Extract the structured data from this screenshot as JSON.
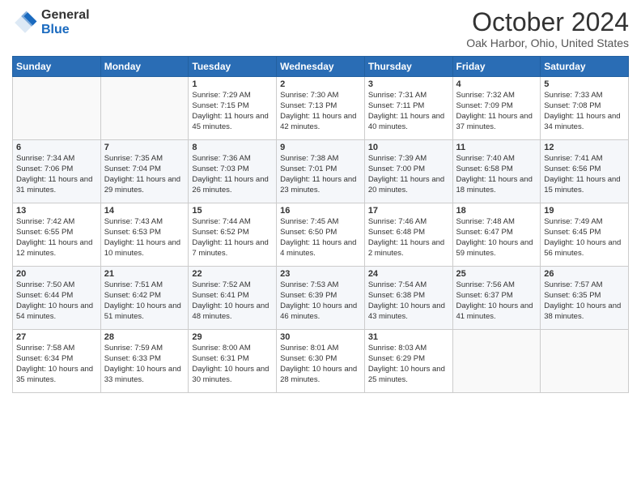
{
  "logo": {
    "general": "General",
    "blue": "Blue"
  },
  "header": {
    "title": "October 2024",
    "subtitle": "Oak Harbor, Ohio, United States"
  },
  "weekdays": [
    "Sunday",
    "Monday",
    "Tuesday",
    "Wednesday",
    "Thursday",
    "Friday",
    "Saturday"
  ],
  "weeks": [
    [
      {
        "day": "",
        "sunrise": "",
        "sunset": "",
        "daylight": ""
      },
      {
        "day": "",
        "sunrise": "",
        "sunset": "",
        "daylight": ""
      },
      {
        "day": "1",
        "sunrise": "Sunrise: 7:29 AM",
        "sunset": "Sunset: 7:15 PM",
        "daylight": "Daylight: 11 hours and 45 minutes."
      },
      {
        "day": "2",
        "sunrise": "Sunrise: 7:30 AM",
        "sunset": "Sunset: 7:13 PM",
        "daylight": "Daylight: 11 hours and 42 minutes."
      },
      {
        "day": "3",
        "sunrise": "Sunrise: 7:31 AM",
        "sunset": "Sunset: 7:11 PM",
        "daylight": "Daylight: 11 hours and 40 minutes."
      },
      {
        "day": "4",
        "sunrise": "Sunrise: 7:32 AM",
        "sunset": "Sunset: 7:09 PM",
        "daylight": "Daylight: 11 hours and 37 minutes."
      },
      {
        "day": "5",
        "sunrise": "Sunrise: 7:33 AM",
        "sunset": "Sunset: 7:08 PM",
        "daylight": "Daylight: 11 hours and 34 minutes."
      }
    ],
    [
      {
        "day": "6",
        "sunrise": "Sunrise: 7:34 AM",
        "sunset": "Sunset: 7:06 PM",
        "daylight": "Daylight: 11 hours and 31 minutes."
      },
      {
        "day": "7",
        "sunrise": "Sunrise: 7:35 AM",
        "sunset": "Sunset: 7:04 PM",
        "daylight": "Daylight: 11 hours and 29 minutes."
      },
      {
        "day": "8",
        "sunrise": "Sunrise: 7:36 AM",
        "sunset": "Sunset: 7:03 PM",
        "daylight": "Daylight: 11 hours and 26 minutes."
      },
      {
        "day": "9",
        "sunrise": "Sunrise: 7:38 AM",
        "sunset": "Sunset: 7:01 PM",
        "daylight": "Daylight: 11 hours and 23 minutes."
      },
      {
        "day": "10",
        "sunrise": "Sunrise: 7:39 AM",
        "sunset": "Sunset: 7:00 PM",
        "daylight": "Daylight: 11 hours and 20 minutes."
      },
      {
        "day": "11",
        "sunrise": "Sunrise: 7:40 AM",
        "sunset": "Sunset: 6:58 PM",
        "daylight": "Daylight: 11 hours and 18 minutes."
      },
      {
        "day": "12",
        "sunrise": "Sunrise: 7:41 AM",
        "sunset": "Sunset: 6:56 PM",
        "daylight": "Daylight: 11 hours and 15 minutes."
      }
    ],
    [
      {
        "day": "13",
        "sunrise": "Sunrise: 7:42 AM",
        "sunset": "Sunset: 6:55 PM",
        "daylight": "Daylight: 11 hours and 12 minutes."
      },
      {
        "day": "14",
        "sunrise": "Sunrise: 7:43 AM",
        "sunset": "Sunset: 6:53 PM",
        "daylight": "Daylight: 11 hours and 10 minutes."
      },
      {
        "day": "15",
        "sunrise": "Sunrise: 7:44 AM",
        "sunset": "Sunset: 6:52 PM",
        "daylight": "Daylight: 11 hours and 7 minutes."
      },
      {
        "day": "16",
        "sunrise": "Sunrise: 7:45 AM",
        "sunset": "Sunset: 6:50 PM",
        "daylight": "Daylight: 11 hours and 4 minutes."
      },
      {
        "day": "17",
        "sunrise": "Sunrise: 7:46 AM",
        "sunset": "Sunset: 6:48 PM",
        "daylight": "Daylight: 11 hours and 2 minutes."
      },
      {
        "day": "18",
        "sunrise": "Sunrise: 7:48 AM",
        "sunset": "Sunset: 6:47 PM",
        "daylight": "Daylight: 10 hours and 59 minutes."
      },
      {
        "day": "19",
        "sunrise": "Sunrise: 7:49 AM",
        "sunset": "Sunset: 6:45 PM",
        "daylight": "Daylight: 10 hours and 56 minutes."
      }
    ],
    [
      {
        "day": "20",
        "sunrise": "Sunrise: 7:50 AM",
        "sunset": "Sunset: 6:44 PM",
        "daylight": "Daylight: 10 hours and 54 minutes."
      },
      {
        "day": "21",
        "sunrise": "Sunrise: 7:51 AM",
        "sunset": "Sunset: 6:42 PM",
        "daylight": "Daylight: 10 hours and 51 minutes."
      },
      {
        "day": "22",
        "sunrise": "Sunrise: 7:52 AM",
        "sunset": "Sunset: 6:41 PM",
        "daylight": "Daylight: 10 hours and 48 minutes."
      },
      {
        "day": "23",
        "sunrise": "Sunrise: 7:53 AM",
        "sunset": "Sunset: 6:39 PM",
        "daylight": "Daylight: 10 hours and 46 minutes."
      },
      {
        "day": "24",
        "sunrise": "Sunrise: 7:54 AM",
        "sunset": "Sunset: 6:38 PM",
        "daylight": "Daylight: 10 hours and 43 minutes."
      },
      {
        "day": "25",
        "sunrise": "Sunrise: 7:56 AM",
        "sunset": "Sunset: 6:37 PM",
        "daylight": "Daylight: 10 hours and 41 minutes."
      },
      {
        "day": "26",
        "sunrise": "Sunrise: 7:57 AM",
        "sunset": "Sunset: 6:35 PM",
        "daylight": "Daylight: 10 hours and 38 minutes."
      }
    ],
    [
      {
        "day": "27",
        "sunrise": "Sunrise: 7:58 AM",
        "sunset": "Sunset: 6:34 PM",
        "daylight": "Daylight: 10 hours and 35 minutes."
      },
      {
        "day": "28",
        "sunrise": "Sunrise: 7:59 AM",
        "sunset": "Sunset: 6:33 PM",
        "daylight": "Daylight: 10 hours and 33 minutes."
      },
      {
        "day": "29",
        "sunrise": "Sunrise: 8:00 AM",
        "sunset": "Sunset: 6:31 PM",
        "daylight": "Daylight: 10 hours and 30 minutes."
      },
      {
        "day": "30",
        "sunrise": "Sunrise: 8:01 AM",
        "sunset": "Sunset: 6:30 PM",
        "daylight": "Daylight: 10 hours and 28 minutes."
      },
      {
        "day": "31",
        "sunrise": "Sunrise: 8:03 AM",
        "sunset": "Sunset: 6:29 PM",
        "daylight": "Daylight: 10 hours and 25 minutes."
      },
      {
        "day": "",
        "sunrise": "",
        "sunset": "",
        "daylight": ""
      },
      {
        "day": "",
        "sunrise": "",
        "sunset": "",
        "daylight": ""
      }
    ]
  ]
}
